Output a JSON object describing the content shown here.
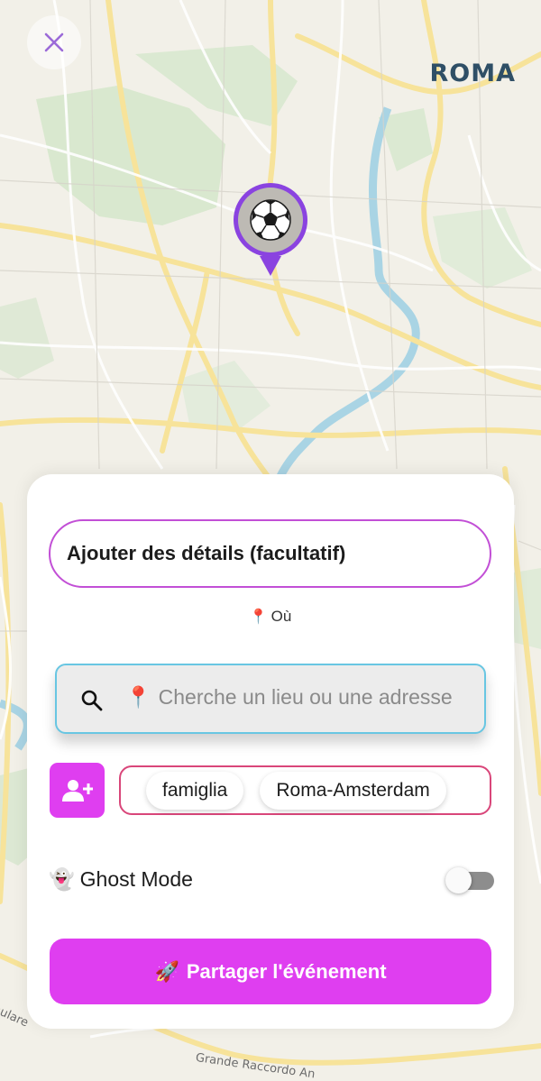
{
  "map": {
    "city_label": "ROMA",
    "road_labels": [
      "nulare",
      "Grande Raccordo An"
    ],
    "pin_icon": "soccer-ball-icon"
  },
  "close_icon": "close-icon",
  "form": {
    "details_placeholder": "Ajouter des détails (facultatif)",
    "where_label": "Où",
    "search_placeholder": "Cherche un lieu ou une adresse",
    "groups": [
      "famiglia",
      "Roma-Amsterdam"
    ],
    "ghost_mode_label": "Ghost Mode",
    "ghost_mode_enabled": false,
    "share_label": "Partager l'événement"
  },
  "colors": {
    "accent": "#df3ef0",
    "details_border": "#c24fd6",
    "search_border": "#68c6e2",
    "groups_border": "#d9467a",
    "pin_ring": "#8a43e0"
  }
}
